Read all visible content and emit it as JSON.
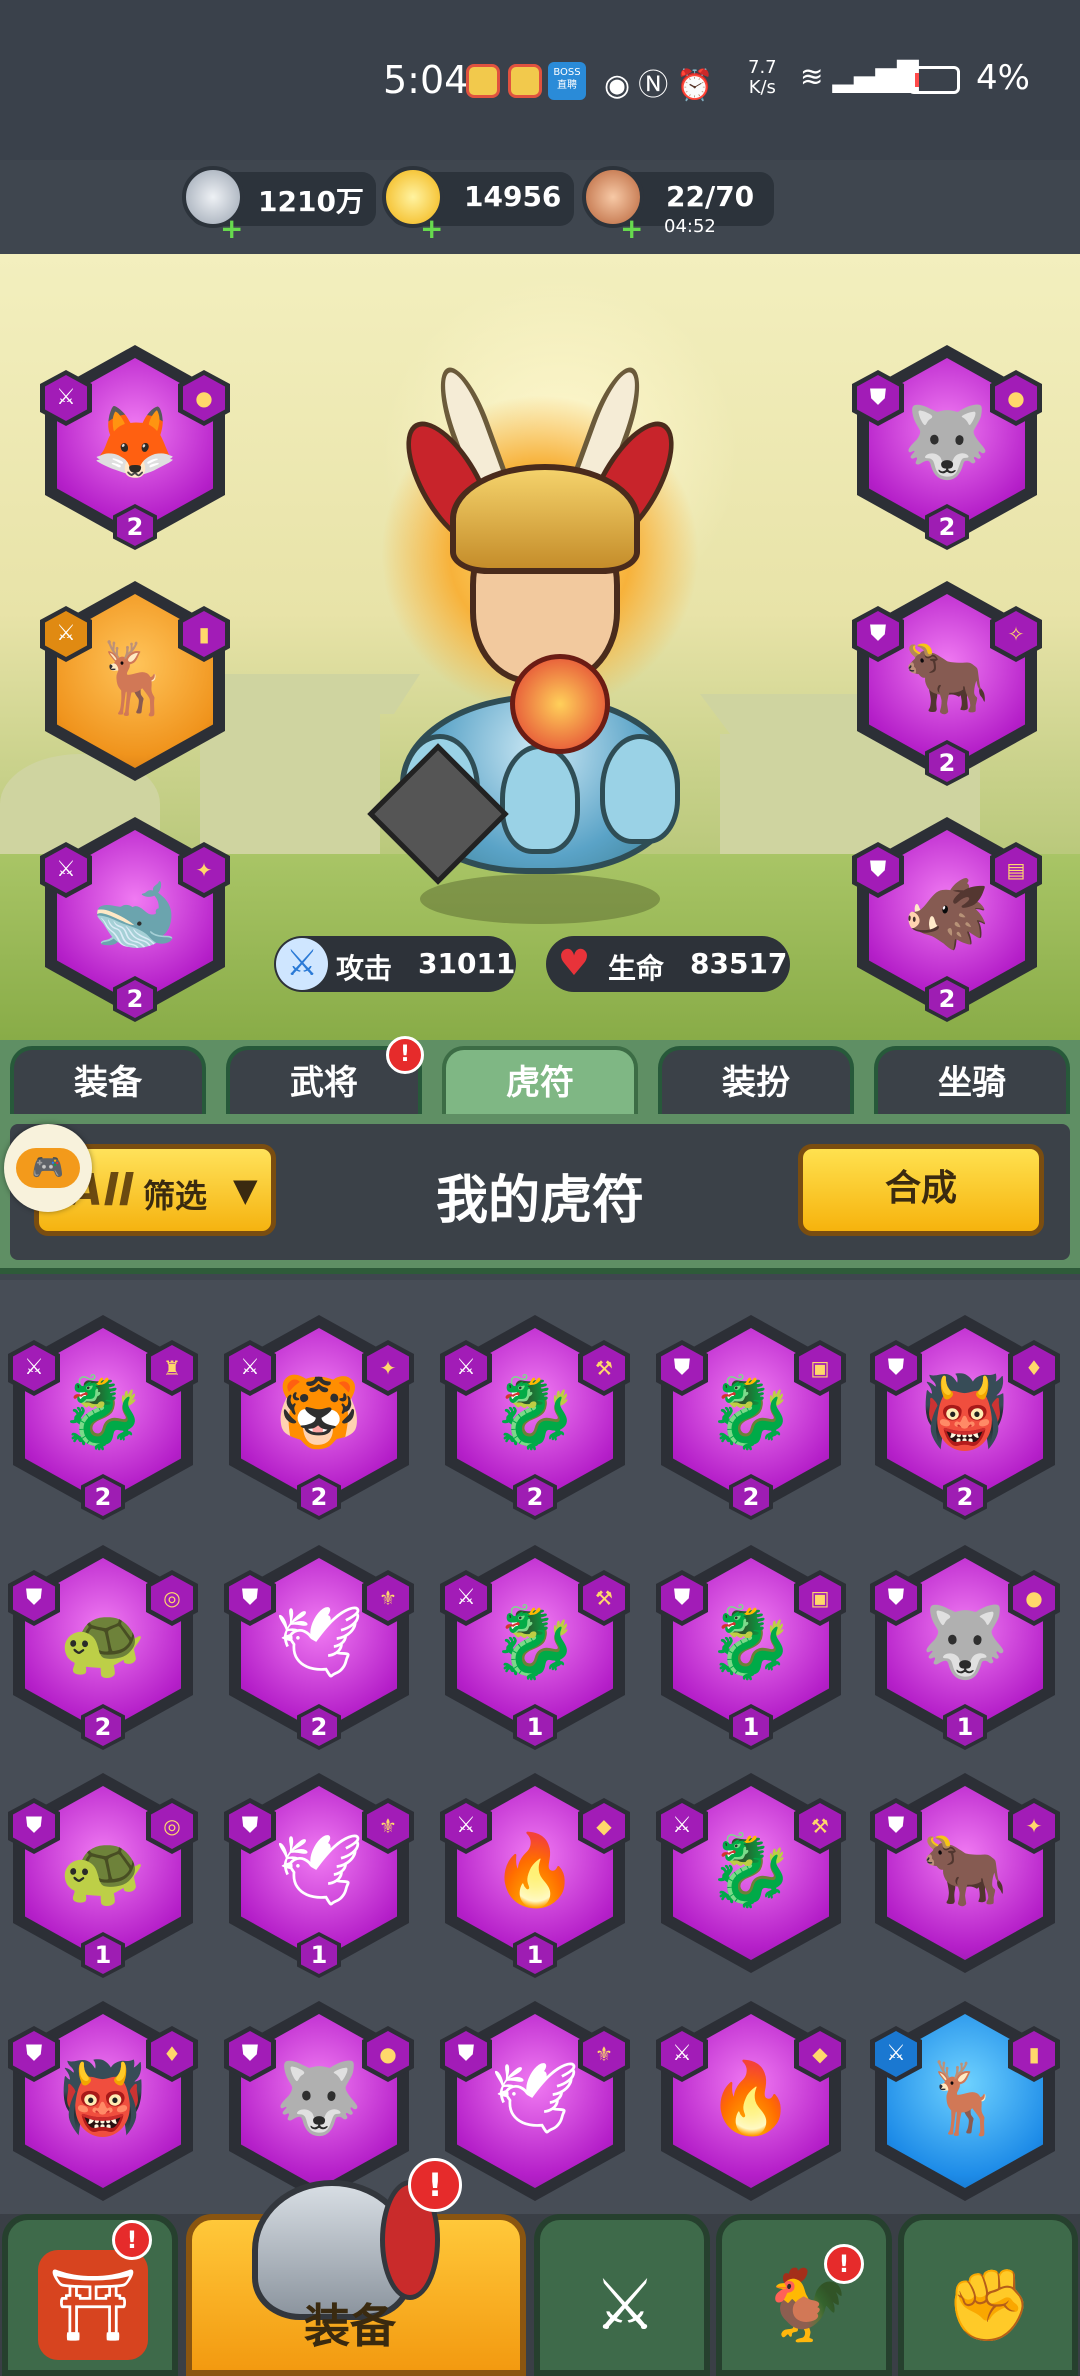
{
  "status_bar": {
    "time": "5:04",
    "boss_label": "BOSS 直聘",
    "net_speed_value": "7.7",
    "net_speed_unit": "K/s",
    "battery": "4%",
    "icons": [
      "weibo-icon",
      "weibo-icon",
      "boss-icon",
      "eye-icon",
      "nfc-icon",
      "alarm-icon",
      "wifi-icon",
      "signal-5g-icon",
      "battery-icon"
    ]
  },
  "resources": {
    "silver": "1210万",
    "gold": "14956",
    "stamina": "22/70",
    "stamina_timer": "04:52"
  },
  "stats": {
    "attack_label": "攻击",
    "attack_value": "31011",
    "hp_label": "生命",
    "hp_value": "83517"
  },
  "equipped": [
    {
      "slot": "left-1",
      "beast": "fox",
      "level": "2",
      "rarity": "purple",
      "type": "attack"
    },
    {
      "slot": "left-2",
      "beast": "deer",
      "level": "",
      "rarity": "gold",
      "type": "attack"
    },
    {
      "slot": "left-3",
      "beast": "whale",
      "level": "2",
      "rarity": "purple",
      "type": "attack"
    },
    {
      "slot": "right-1",
      "beast": "wolf",
      "level": "2",
      "rarity": "purple",
      "type": "defense"
    },
    {
      "slot": "right-2",
      "beast": "bull",
      "level": "2",
      "rarity": "purple",
      "type": "defense"
    },
    {
      "slot": "right-3",
      "beast": "boar",
      "level": "2",
      "rarity": "purple",
      "type": "defense"
    }
  ],
  "tabs": [
    "装备",
    "武将",
    "虎符",
    "装扮",
    "坐骑"
  ],
  "active_tab": "虎符",
  "tab_badge": "!",
  "panel": {
    "filter_all": "All",
    "filter_label": "筛选",
    "title": "我的虎符",
    "merge_label": "合成"
  },
  "grid": [
    {
      "beast": "dragon",
      "level": "2",
      "type": "attack"
    },
    {
      "beast": "tiger",
      "level": "2",
      "type": "attack"
    },
    {
      "beast": "dragon",
      "level": "2",
      "type": "attack"
    },
    {
      "beast": "dragon",
      "level": "2",
      "type": "defense"
    },
    {
      "beast": "demon",
      "level": "2",
      "type": "defense"
    },
    {
      "beast": "turtle",
      "level": "2",
      "type": "defense"
    },
    {
      "beast": "phoenix",
      "level": "2",
      "type": "defense"
    },
    {
      "beast": "dragon",
      "level": "1",
      "type": "attack"
    },
    {
      "beast": "dragon",
      "level": "1",
      "type": "defense"
    },
    {
      "beast": "wolf",
      "level": "1",
      "type": "defense"
    },
    {
      "beast": "turtle",
      "level": "1",
      "type": "defense"
    },
    {
      "beast": "phoenix",
      "level": "1",
      "type": "defense"
    },
    {
      "beast": "flame",
      "level": "1",
      "type": "attack"
    },
    {
      "beast": "dragon",
      "level": "",
      "type": "attack"
    },
    {
      "beast": "bull",
      "level": "",
      "type": "defense"
    },
    {
      "beast": "demon",
      "level": "",
      "type": "defense"
    },
    {
      "beast": "wolf",
      "level": "",
      "type": "defense"
    },
    {
      "beast": "phoenix",
      "level": "",
      "type": "defense"
    },
    {
      "beast": "flame",
      "level": "",
      "type": "attack"
    },
    {
      "beast": "deer",
      "level": "",
      "type": "attack",
      "rarity": "blue"
    }
  ],
  "bottom_nav": {
    "active_label": "装备",
    "badge": "!"
  }
}
